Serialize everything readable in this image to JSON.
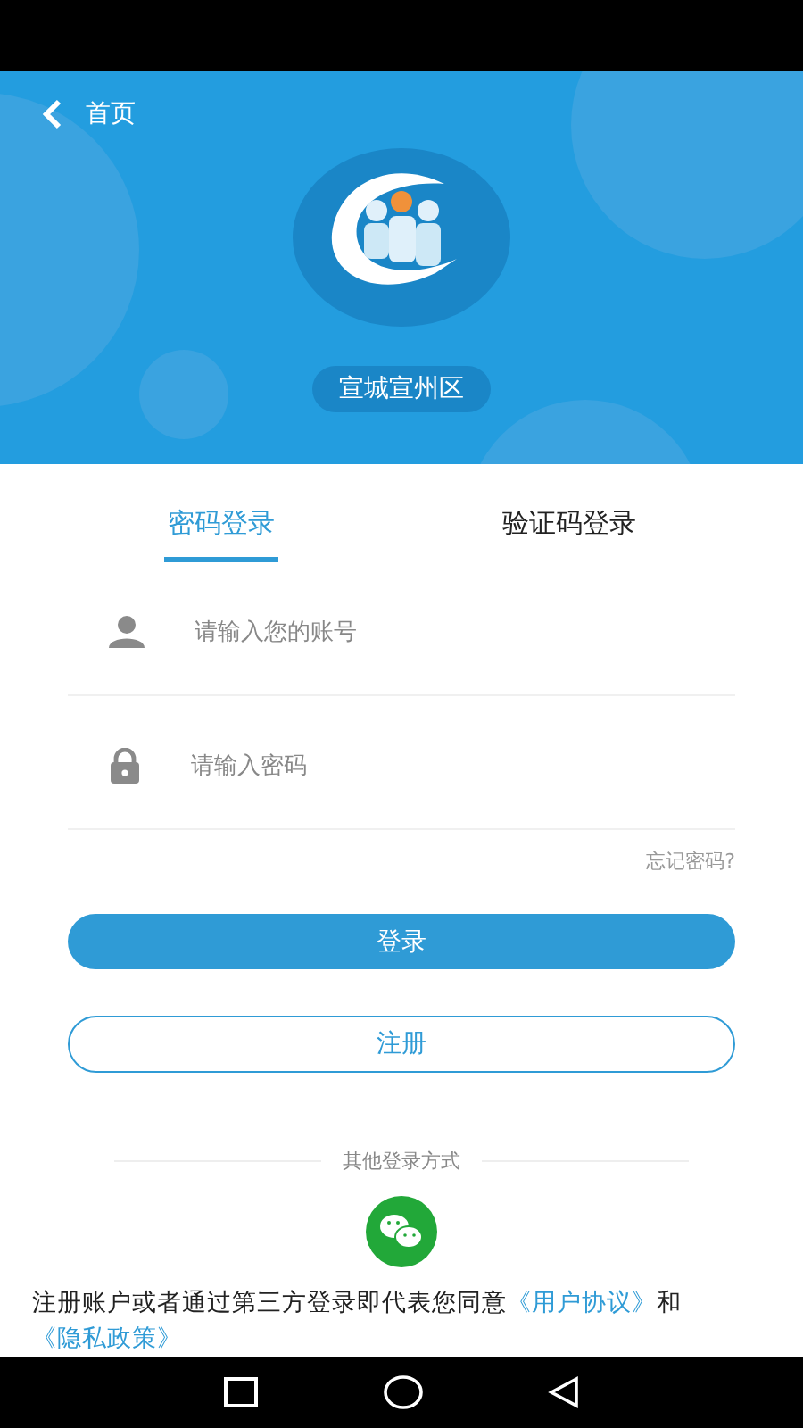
{
  "header": {
    "back_label": "首页",
    "region": "宣城宣州区"
  },
  "tabs": [
    {
      "label": "密码登录",
      "selected": true
    },
    {
      "label": "验证码登录",
      "selected": false
    }
  ],
  "fields": [
    {
      "kind": "account",
      "placeholder": "请输入您的账号"
    },
    {
      "kind": "password",
      "placeholder": "请输入密码"
    }
  ],
  "forgot_link": "忘记密码?",
  "login_button": "登录",
  "register_button": "注册",
  "other_login_label": "其他登录方式",
  "agreement": {
    "text": "注册账户或者通过第三方登录即代表您同意",
    "user_agreement": "《用户协议》",
    "conjunction": "和",
    "privacy_policy": "《隐私政策》"
  }
}
